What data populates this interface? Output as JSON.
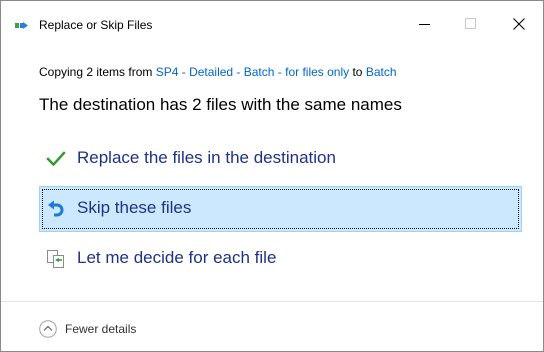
{
  "window": {
    "title": "Replace or Skip Files",
    "minimize_icon": "minimize-icon",
    "maximize_icon": "maximize-icon",
    "close_icon": "close-icon"
  },
  "copy_info": {
    "prefix": "Copying 2 items from ",
    "source": "SP4 - Detailed - Batch - for files only",
    "middle": " to ",
    "destination": "Batch"
  },
  "headline": "The destination has 2 files with the same names",
  "options": [
    {
      "label": "Replace the files in the destination",
      "icon": "checkmark-icon",
      "selected": false
    },
    {
      "label": "Skip these files",
      "icon": "skip-icon",
      "selected": true
    },
    {
      "label": "Let me decide for each file",
      "icon": "compare-files-icon",
      "selected": false
    }
  ],
  "footer": {
    "details_label": "Fewer details",
    "icon": "chevron-up-circle-icon"
  },
  "colors": {
    "link": "#0066cc",
    "option_text": "#1e3287",
    "selected_bg": "#cce8ff",
    "selected_border": "#99d1ff",
    "check": "#2c9a2c",
    "skip": "#1f7ad6"
  }
}
